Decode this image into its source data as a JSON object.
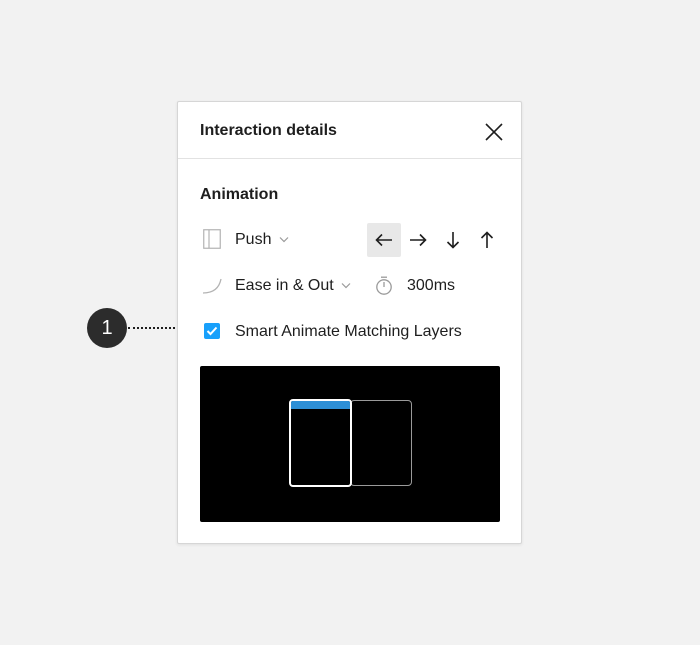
{
  "callout": {
    "number": "1"
  },
  "panel": {
    "title": "Interaction details",
    "close_icon": "close-icon"
  },
  "animation": {
    "section_title": "Animation",
    "type": {
      "icon": "push-transition-icon",
      "value": "Push"
    },
    "directions": [
      {
        "icon": "arrow-left-icon",
        "glyph": "←",
        "active": true
      },
      {
        "icon": "arrow-right-icon",
        "glyph": "→",
        "active": false
      },
      {
        "icon": "arrow-down-icon",
        "glyph": "↓",
        "active": false
      },
      {
        "icon": "arrow-up-icon",
        "glyph": "↑",
        "active": false
      }
    ],
    "easing": {
      "icon": "easing-curve-icon",
      "value": "Ease in & Out"
    },
    "duration": {
      "icon": "timer-icon",
      "value": "300ms"
    },
    "smart_animate": {
      "checked": true,
      "label": "Smart Animate Matching Layers"
    }
  },
  "colors": {
    "accent": "#18a0fb",
    "preview_bar": "#2d8fd6",
    "callout": "#2c2c2c"
  }
}
